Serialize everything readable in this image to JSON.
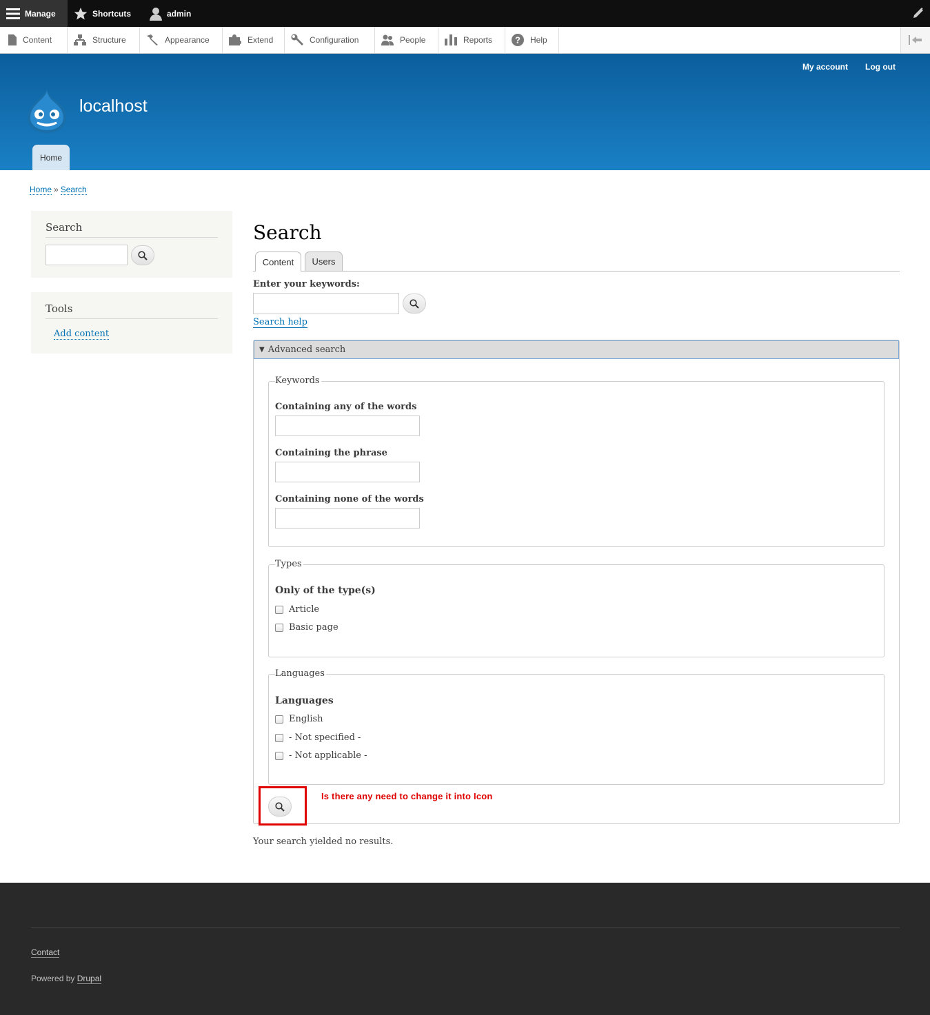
{
  "toolbar": {
    "manage": "Manage",
    "shortcuts": "Shortcuts",
    "user": "admin"
  },
  "tray": {
    "items": [
      {
        "label": "Content",
        "icon": "file-icon"
      },
      {
        "label": "Structure",
        "icon": "sitemap-icon"
      },
      {
        "label": "Appearance",
        "icon": "paintbrush-icon"
      },
      {
        "label": "Extend",
        "icon": "puzzle-icon"
      },
      {
        "label": "Configuration",
        "icon": "wrench-icon"
      },
      {
        "label": "People",
        "icon": "people-icon"
      },
      {
        "label": "Reports",
        "icon": "bar-chart-icon"
      },
      {
        "label": "Help",
        "icon": "help-icon"
      }
    ]
  },
  "header": {
    "site_name": "localhost",
    "secondary_menu": [
      "My account",
      "Log out"
    ],
    "main_menu": [
      "Home"
    ]
  },
  "breadcrumb": {
    "items": [
      "Home",
      "Search"
    ],
    "separator": "»"
  },
  "sidebar": {
    "search_block": {
      "title": "Search"
    },
    "tools_block": {
      "title": "Tools",
      "link": "Add content"
    }
  },
  "main": {
    "title": "Search",
    "tabs": [
      "Content",
      "Users"
    ],
    "keywords_label": "Enter your keywords:",
    "search_help": "Search help",
    "advanced": {
      "summary": "Advanced search",
      "keywords_legend": "Keywords",
      "any_words_label": "Containing any of the words",
      "phrase_label": "Containing the phrase",
      "none_words_label": "Containing none of the words",
      "types_legend": "Types",
      "types_label": "Only of the type(s)",
      "types_options": [
        "Article",
        "Basic page"
      ],
      "languages_legend": "Languages",
      "languages_label": "Languages",
      "languages_options": [
        "English",
        "- Not specified -",
        "- Not applicable -"
      ]
    },
    "annotation": "Is there any need to change it into Icon",
    "no_results": "Your search yielded no results."
  },
  "footer": {
    "contact": "Contact",
    "powered_prefix": "Powered by",
    "powered_link": "Drupal"
  },
  "colors": {
    "header_top": "#0c5e9c",
    "header_bottom": "#1a80c5",
    "link": "#0071b3",
    "annotation": "#e00000",
    "footer": "#292929"
  }
}
